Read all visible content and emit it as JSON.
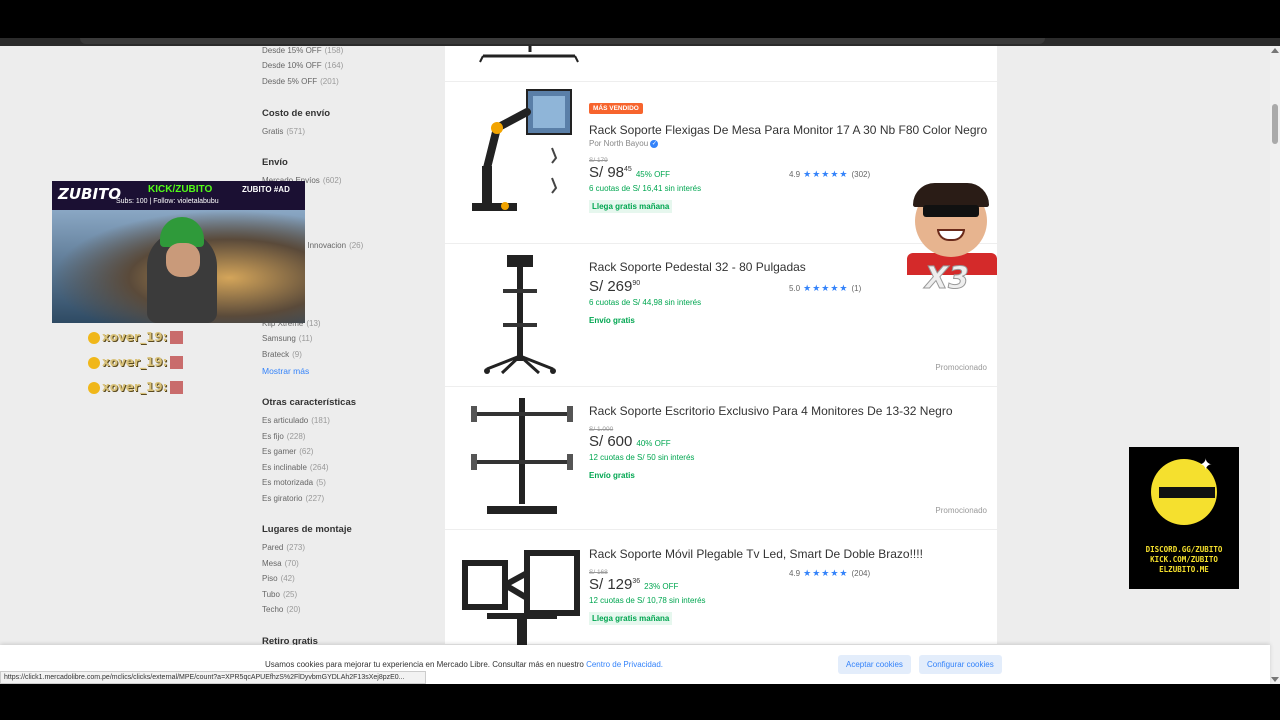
{
  "filters": {
    "discounts": [
      {
        "label": "Desde 15% OFF",
        "count": "(158)"
      },
      {
        "label": "Desde 10% OFF",
        "count": "(164)"
      },
      {
        "label": "Desde 5% OFF",
        "count": "(201)"
      }
    ],
    "shipping_cost_title": "Costo de envío",
    "shipping_cost": {
      "label": "Gratis",
      "count": "(571)"
    },
    "shipping_title": "Envío",
    "shipping_partial": {
      "label": "Mercado Envíos",
      "count": "(602)"
    },
    "brand_partial": [
      {
        "label": "Seguridad e Innovacion",
        "count": "(26)"
      },
      {
        "label": "Klip Xtreme",
        "count": "(13)"
      },
      {
        "label": "Samsung",
        "count": "(11)"
      },
      {
        "label": "Brateck",
        "count": "(9)"
      }
    ],
    "show_more": "Mostrar más",
    "other_title": "Otras características",
    "other": [
      {
        "label": "Es articulado",
        "count": "(181)"
      },
      {
        "label": "Es fijo",
        "count": "(228)"
      },
      {
        "label": "Es gamer",
        "count": "(62)"
      },
      {
        "label": "Es inclinable",
        "count": "(264)"
      },
      {
        "label": "Es motorizada",
        "count": "(5)"
      },
      {
        "label": "Es giratorio",
        "count": "(227)"
      }
    ],
    "mount_title": "Lugares de montaje",
    "mount": [
      {
        "label": "Pared",
        "count": "(273)"
      },
      {
        "label": "Mesa",
        "count": "(70)"
      },
      {
        "label": "Piso",
        "count": "(42)"
      },
      {
        "label": "Tubo",
        "count": "(25)"
      },
      {
        "label": "Techo",
        "count": "(20)"
      }
    ],
    "pickup_title": "Retiro gratis"
  },
  "products": [
    {
      "badge": "MÁS VENDIDO",
      "title": "Rack Soporte Flexigas De Mesa Para Monitor 17 A 30 Nb F80 Color Negro",
      "seller": "Por North Bayou",
      "old_price": "S/ 179",
      "price": "S/ 98",
      "cents": "45",
      "off": "45% OFF",
      "cuotas": "6 cuotas de S/ 16,41 sin interés",
      "shipping": "Llega gratis mañana",
      "rating": "4.9",
      "reviews": "(302)"
    },
    {
      "title": "Rack Soporte Pedestal 32 - 80 Pulgadas",
      "price": "S/ 269",
      "cents": "90",
      "cuotas": "6 cuotas de S/ 44,98 sin interés",
      "shipping": "Envío gratis",
      "rating": "5.0",
      "reviews": "(1)",
      "promo": "Promocionado"
    },
    {
      "title": "Rack Soporte Escritorio Exclusivo Para 4 Monitores De 13-32 Negro",
      "old_price": "S/ 1.000",
      "price": "S/ 600",
      "off": "40% OFF",
      "cuotas": "12 cuotas de S/ 50 sin interés",
      "shipping": "Envío gratis",
      "promo": "Promocionado"
    },
    {
      "title": "Rack Soporte Móvil Plegable Tv Led, Smart De Doble Brazo!!!!",
      "old_price": "S/ 168",
      "price": "S/ 129",
      "cents": "36",
      "off": "23% OFF",
      "cuotas": "12 cuotas de S/ 10,78 sin interés",
      "shipping": "Llega gratis mañana",
      "rating": "4.9",
      "reviews": "(204)"
    }
  ],
  "stars": "★★★★★",
  "cookie": {
    "message": "Usamos cookies para mejorar tu experiencia en Mercado Libre. Consultar más en nuestro",
    "privacy_link": "Centro de Privacidad.",
    "accept": "Aceptar cookies",
    "configure": "Configurar cookies"
  },
  "status_url": "https://click1.mercadolibre.com.pe/mclics/clicks/external/MPE/count?a=XPR5qcAPUEfhzS%2FlDyvbmGYDLAh2F13sXej8pzE0...",
  "stream": {
    "brand": "ZUBITO",
    "kick": "KICK/ZUBITO",
    "subs": "Subs: 100 | Follow: violetalabubu",
    "side": "ZUBITO #AD",
    "chat": [
      "xover_19:",
      "xover_19:",
      "xover_19:"
    ],
    "sticker": "X3",
    "discord_lines": [
      "DISCORD.GG/ZUBITO",
      "KICK.COM/ZUBITO",
      "ELZUBITO.ME"
    ]
  }
}
